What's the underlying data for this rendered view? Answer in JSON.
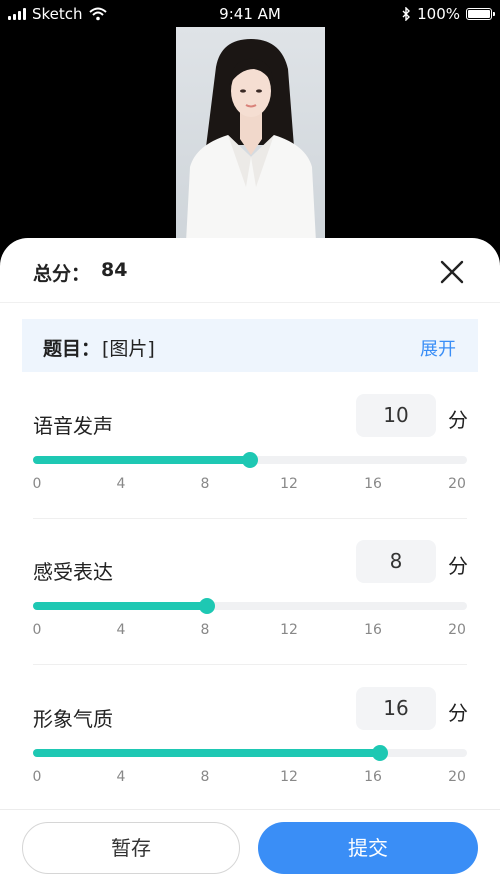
{
  "status_bar": {
    "carrier": "Sketch",
    "time": "9:41 AM",
    "battery": "100%"
  },
  "header": {
    "total_label": "总分：",
    "total_value": "84"
  },
  "topic": {
    "label": "题目：",
    "value": "[图片]",
    "expand_label": "展开"
  },
  "scale": {
    "min": 0,
    "max": 20,
    "ticks": [
      "0",
      "4",
      "8",
      "12",
      "16",
      "20"
    ]
  },
  "items": [
    {
      "name": "语音发声",
      "score": "10",
      "unit": "分",
      "value": 10
    },
    {
      "name": "感受表达",
      "score": "8",
      "unit": "分",
      "value": 8
    },
    {
      "name": "形象气质",
      "score": "16",
      "unit": "分",
      "value": 16
    }
  ],
  "colors": {
    "accent": "#1ec8b3",
    "primary": "#3a8ef6",
    "topic_bg": "#eef5fd"
  },
  "footer": {
    "save_label": "暂存",
    "submit_label": "提交"
  }
}
